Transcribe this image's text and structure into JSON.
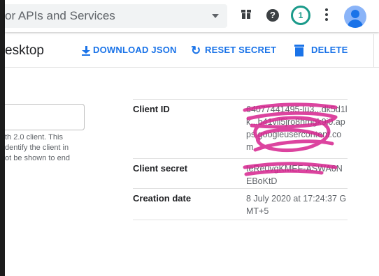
{
  "header": {
    "search_text": "or APIs and Services",
    "notification_count": "1",
    "help_glyph": "?"
  },
  "actions": {
    "page_title": "esktop",
    "download_label": "DOWNLOAD JSON",
    "reset_label": "RESET SECRET",
    "delete_label": "DELETE"
  },
  "form": {
    "helper_text": "th 2.0 client. This\ndentify the client in\not be shown to end"
  },
  "details": {
    "client_id_label": "Client ID",
    "client_id_value": "64077441495-lu3...dk5d1lk...b41vil5jro8hmgk9i0.apps.googleusercontent.com",
    "client_secret_label": "Client secret",
    "client_secret_value": "teRe0vgKMEF-ASWA6NEBoKtD",
    "creation_date_label": "Creation date",
    "creation_date_value": "8 July 2020 at 17:24:37 GMT+5"
  },
  "colors": {
    "accent": "#1a73e8",
    "notification": "#1a9a8a",
    "redaction": "#d6248f"
  },
  "icons": [
    "gift-icon",
    "help-icon",
    "notification-icon",
    "more-vert-icon",
    "avatar",
    "download-icon",
    "refresh-icon",
    "delete-icon",
    "chevron-down-icon"
  ]
}
